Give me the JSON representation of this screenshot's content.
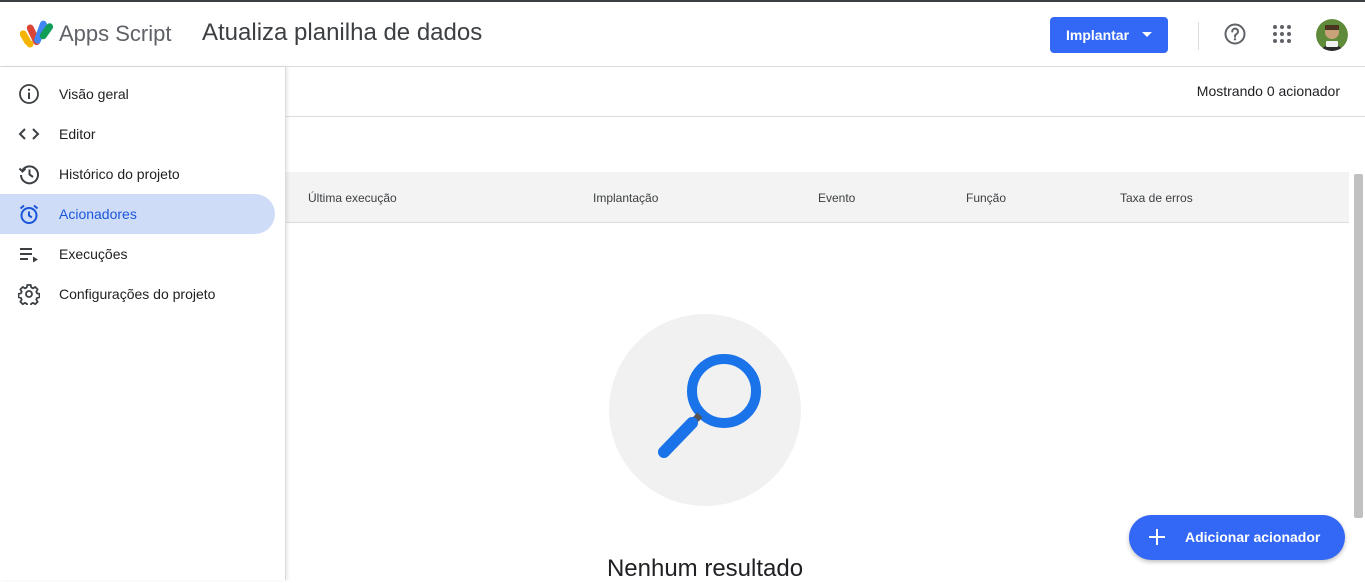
{
  "header": {
    "brand": "Apps Script",
    "project_title": "Atualiza planilha de dados",
    "deploy_label": "Implantar"
  },
  "sidebar": {
    "items": [
      {
        "label": "Visão geral",
        "icon": "info-icon"
      },
      {
        "label": "Editor",
        "icon": "code-icon"
      },
      {
        "label": "Histórico do projeto",
        "icon": "history-icon"
      },
      {
        "label": "Acionadores",
        "icon": "alarm-icon",
        "active": true
      },
      {
        "label": "Execuções",
        "icon": "playlist-play-icon"
      },
      {
        "label": "Configurações do projeto",
        "icon": "gear-icon"
      }
    ]
  },
  "main": {
    "showing_text": "Mostrando 0 acionador",
    "columns": [
      "Última execução",
      "Implantação",
      "Evento",
      "Função",
      "Taxa de erros"
    ],
    "empty_text": "Nenhum resultado",
    "add_trigger_label": "Adicionar acionador"
  },
  "colors": {
    "accent": "#3367f5",
    "active_nav_bg": "#cfdcf7",
    "magnifier": "#1a73e8"
  }
}
